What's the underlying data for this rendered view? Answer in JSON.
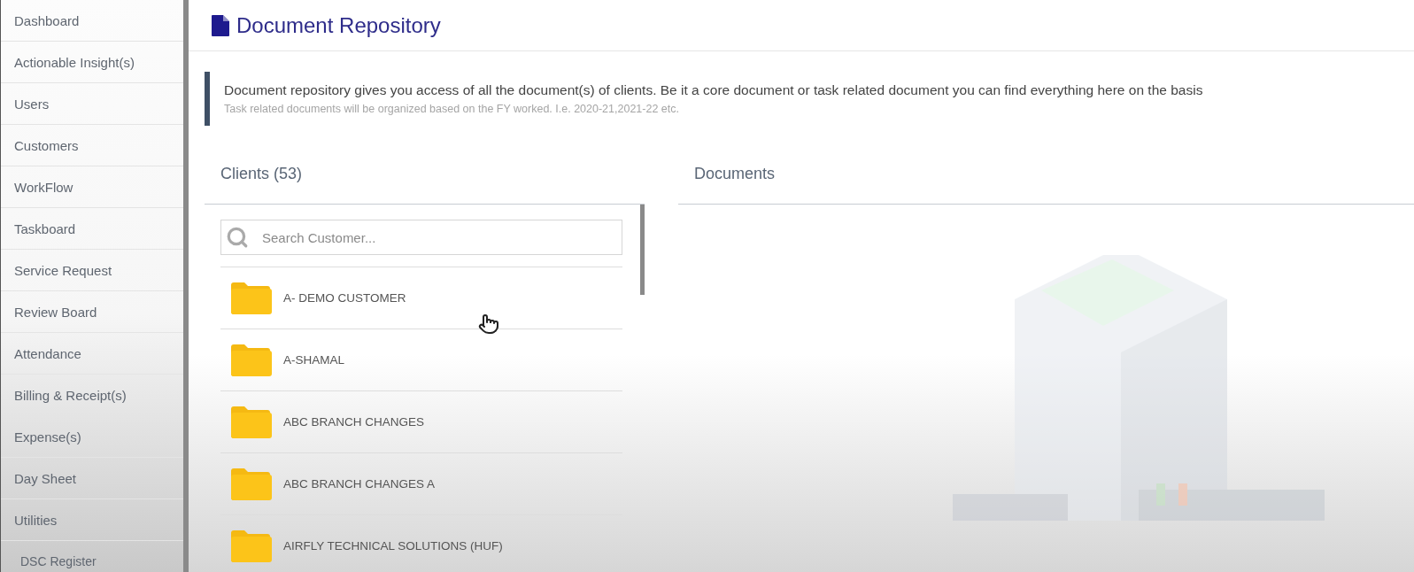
{
  "sidebar": {
    "items": [
      {
        "label": "Dashboard"
      },
      {
        "label": "Actionable Insight(s)"
      },
      {
        "label": "Users"
      },
      {
        "label": "Customers"
      },
      {
        "label": "WorkFlow"
      },
      {
        "label": "Taskboard"
      },
      {
        "label": "Service Request"
      },
      {
        "label": "Review Board"
      },
      {
        "label": "Attendance"
      },
      {
        "label": "Billing & Receipt(s)"
      },
      {
        "label": "Expense(s)"
      },
      {
        "label": "Day Sheet"
      },
      {
        "label": "Utilities",
        "children": [
          {
            "label": "DSC Register"
          }
        ]
      }
    ]
  },
  "page": {
    "title": "Document Repository"
  },
  "info": {
    "text": "Document repository gives you access of all the document(s) of clients. Be it a core document or task related document you can find everything here on the basis",
    "note": "Task related documents will be organized based on the FY worked. I.e. 2020-21,2021-22 etc."
  },
  "clients": {
    "title": "Clients (53)",
    "search": {
      "placeholder": "Search Customer..."
    },
    "items": [
      {
        "name": "A- DEMO CUSTOMER"
      },
      {
        "name": "A-SHAMAL"
      },
      {
        "name": "ABC BRANCH CHANGES"
      },
      {
        "name": "ABC BRANCH CHANGES A"
      },
      {
        "name": "AIRFLY TECHNICAL SOLUTIONS (HUF)"
      }
    ]
  },
  "documents": {
    "title": "Documents"
  }
}
